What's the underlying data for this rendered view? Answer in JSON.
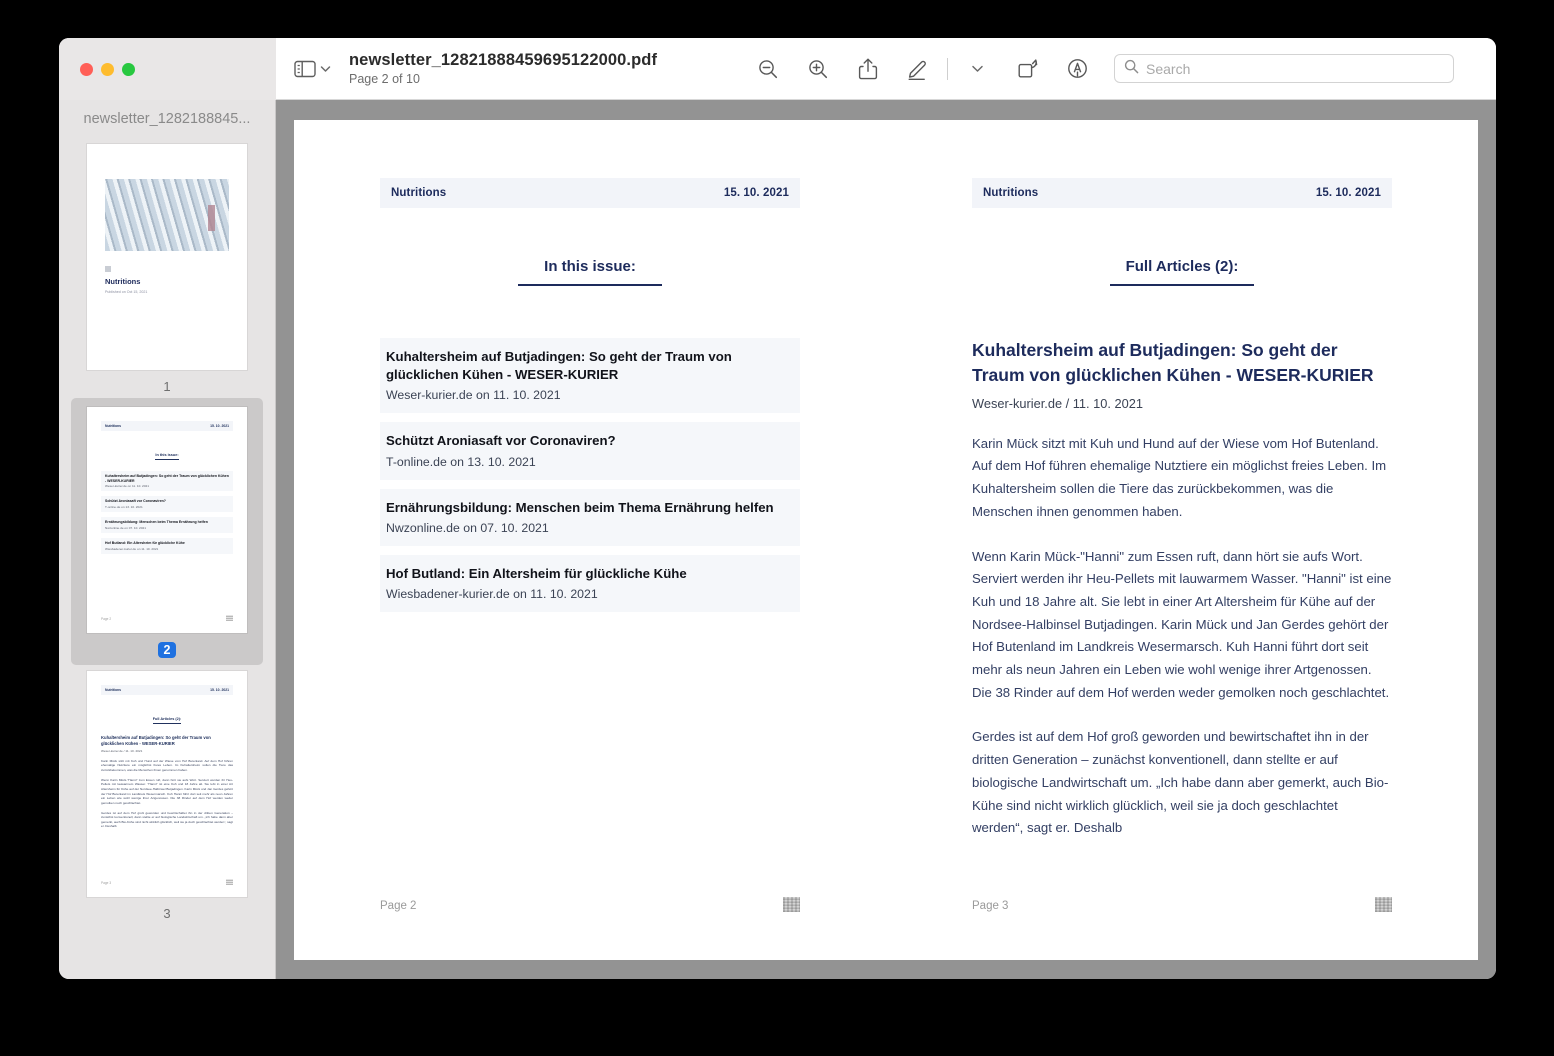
{
  "window": {
    "traffic_lights": [
      "close",
      "minimize",
      "maximize"
    ]
  },
  "titlebar": {
    "sidebar_toggle_icon": "sidebar-icon",
    "sidebar_chevron_icon": "chevron-down-icon",
    "doc_title": "newsletter_12821888459695122000.pdf",
    "doc_subtitle": "Page 2 of 10",
    "tools": [
      {
        "name": "zoom-out-icon",
        "label": "Zoom Out"
      },
      {
        "name": "zoom-in-icon",
        "label": "Zoom In"
      },
      {
        "name": "share-icon",
        "label": "Share"
      },
      {
        "name": "markup-icon",
        "label": "Markup"
      },
      {
        "name": "chevron-down-icon",
        "label": "Markup Options"
      },
      {
        "name": "rotate-icon",
        "label": "Rotate Left"
      },
      {
        "name": "annotate-icon",
        "label": "Annotate"
      }
    ],
    "search": {
      "placeholder": "Search",
      "value": "",
      "icon": "search-icon"
    }
  },
  "sidebar": {
    "title": "newsletter_1282188845...",
    "thumbnails": [
      {
        "page_label": "1",
        "selected": false,
        "kind": "cover"
      },
      {
        "page_label": "2",
        "selected": true,
        "kind": "toc"
      },
      {
        "page_label": "3",
        "selected": false,
        "kind": "article"
      }
    ],
    "cover": {
      "title": "Nutritions",
      "subtitle": "Published on Oct 15, 2021"
    }
  },
  "document": {
    "left_page": {
      "header": {
        "brand": "Nutritions",
        "date": "15. 10. 2021"
      },
      "section_title": "In this issue:",
      "items": [
        {
          "title": "Kuhaltersheim auf Butjadingen: So geht der Traum von glücklichen Kühen - WESER-KURIER",
          "source": "Weser-kurier.de on 11. 10. 2021"
        },
        {
          "title": "Schützt Aroniasaft vor Coronaviren?",
          "source": "T-online.de on 13. 10. 2021"
        },
        {
          "title": "Ernährungsbildung: Menschen beim Thema Ernährung helfen",
          "source": "Nwzonline.de on 07. 10. 2021"
        },
        {
          "title": "Hof Butland: Ein Altersheim für glückliche Kühe",
          "source": "Wiesbadener-kurier.de on 11. 10. 2021"
        }
      ],
      "footer": {
        "label": "Page 2",
        "logo": "publisher-logo"
      }
    },
    "right_page": {
      "header": {
        "brand": "Nutritions",
        "date": "15. 10. 2021"
      },
      "section_title": "Full Articles (2):",
      "article": {
        "title": "Kuhaltersheim auf Butjadingen: So geht der Traum von glücklichen Kühen - WESER-KURIER",
        "source": "Weser-kurier.de / 11. 10. 2021",
        "paragraphs": [
          "Karin Mück sitzt mit Kuh und Hund auf der Wiese vom Hof Butenland. Auf dem Hof führen ehemalige Nutztiere ein möglichst freies Leben. Im Kuhaltersheim sollen die Tiere das zurückbekommen, was die Menschen ihnen genommen haben.",
          "Wenn Karin Mück-\"Hanni\" zum Essen ruft, dann hört sie aufs Wort. Serviert werden ihr Heu-Pellets mit lauwarmem Wasser. \"Hanni\" ist eine Kuh und 18 Jahre alt. Sie lebt in einer Art Altersheim für Kühe auf der Nordsee-Halbinsel Butjadingen. Karin Mück und Jan Gerdes gehört der Hof Butenland im Landkreis Wesermarsch. Kuh Hanni führt dort seit mehr als neun Jahren ein Leben wie wohl wenige ihrer Artgenossen. Die 38 Rinder auf dem Hof werden weder gemolken noch geschlachtet.",
          "Gerdes ist auf dem Hof groß geworden und bewirtschaftet ihn in der dritten Generation – zunächst konventionell, dann stellte er auf biologische Landwirtschaft um. „Ich habe dann aber gemerkt, auch Bio-Kühe sind nicht wirklich glücklich, weil sie ja doch geschlachtet werden“, sagt er. Deshalb"
        ]
      },
      "footer": {
        "label": "Page 3",
        "logo": "publisher-logo"
      }
    }
  },
  "colors": {
    "accent_navy": "#1d2b5c",
    "selection_blue": "#1f71e0",
    "viewer_background": "#939393",
    "sidebar_background": "#e6e4e4",
    "item_background": "#f5f7fa"
  }
}
